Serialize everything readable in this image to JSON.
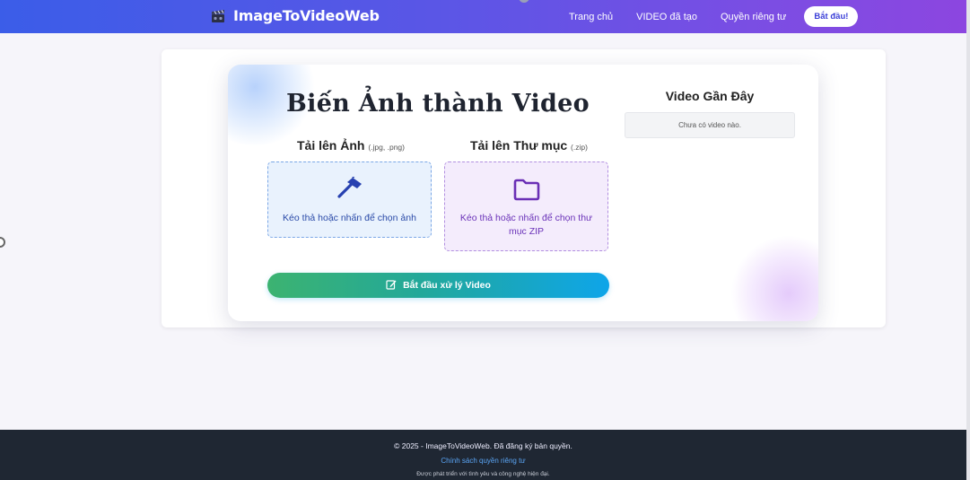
{
  "header": {
    "brand": "ImageToVideoWeb",
    "brand_icon": "film-clapper-icon",
    "nav": [
      "Trang chủ",
      "VIDEO đã tạo",
      "Quyền riêng tư"
    ],
    "cta": "Bắt đầu!"
  },
  "main": {
    "title": "Biến Ảnh thành Video",
    "upload_image": {
      "heading": "Tải lên Ảnh",
      "hint": "(.jpg, .png)",
      "drop_text": "Kéo thả hoặc nhấn để chọn ảnh",
      "icon": "hammer-icon"
    },
    "upload_zip": {
      "heading": "Tải lên Thư mục",
      "hint": "(.zip)",
      "drop_text": "Kéo thả hoặc nhấn để chọn thư mục ZIP",
      "icon": "folder-icon"
    },
    "process_button": "Bắt đầu xử lý Video",
    "process_icon": "edit-icon"
  },
  "recent": {
    "title": "Video Gần Đây",
    "empty": "Chưa có video nào."
  },
  "footer": {
    "copyright": "© 2025 - ImageToVideoWeb. Đã đăng ký bản quyền.",
    "privacy_link": "Chính sách quyền riêng tư",
    "note": "Được phát triển với tình yêu và công nghệ hiện đại."
  },
  "colors": {
    "header_gradient_start": "#3b5de8",
    "header_gradient_end": "#8c46e0",
    "button_gradient_start": "#3cb371",
    "button_gradient_end": "#0ea5e9",
    "image_drop_accent": "#2a4aa8",
    "zip_drop_accent": "#6a32b8",
    "footer_bg": "#1f2733"
  }
}
